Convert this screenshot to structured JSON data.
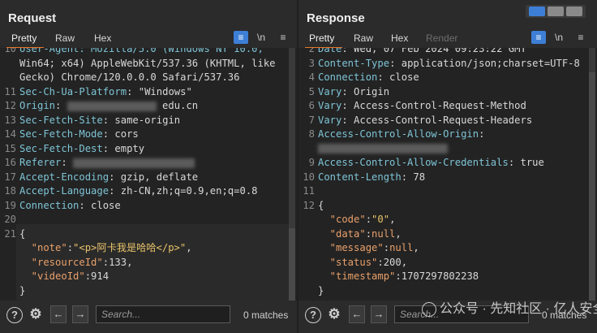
{
  "request": {
    "title": "Request",
    "tabs": [
      "Pretty",
      "Raw",
      "Hex"
    ],
    "lines": [
      {
        "n": "10",
        "segs": [
          {
            "t": "User-Agent: Mozilla/5.0 (Windows NT 10.0;",
            "c": "hk"
          }
        ]
      },
      {
        "n": "",
        "segs": [
          {
            "t": "Win64; x64) AppleWebKit/537.36 (KHTML, like",
            "c": ""
          }
        ]
      },
      {
        "n": "",
        "segs": [
          {
            "t": "Gecko) Chrome/120.0.0.0 Safari/537.36",
            "c": ""
          }
        ]
      },
      {
        "n": "11",
        "segs": [
          {
            "t": "Sec-Ch-Ua-Platform",
            "c": "hk"
          },
          {
            "t": ": \"Windows\"",
            "c": ""
          }
        ]
      },
      {
        "n": "12",
        "segs": [
          {
            "t": "Origin",
            "c": "hk"
          },
          {
            "t": ": ",
            "c": ""
          },
          {
            "t": "",
            "c": "blur",
            "w": 110
          },
          {
            "t": " edu.cn",
            "c": ""
          }
        ]
      },
      {
        "n": "13",
        "segs": [
          {
            "t": "Sec-Fetch-Site",
            "c": "hk"
          },
          {
            "t": ": same-origin",
            "c": ""
          }
        ]
      },
      {
        "n": "14",
        "segs": [
          {
            "t": "Sec-Fetch-Mode",
            "c": "hk"
          },
          {
            "t": ": cors",
            "c": ""
          }
        ]
      },
      {
        "n": "15",
        "segs": [
          {
            "t": "Sec-Fetch-Dest",
            "c": "hk"
          },
          {
            "t": ": empty",
            "c": ""
          }
        ]
      },
      {
        "n": "16",
        "segs": [
          {
            "t": "Referer",
            "c": "hk"
          },
          {
            "t": ": ",
            "c": ""
          },
          {
            "t": "",
            "c": "blur",
            "w": 150
          }
        ]
      },
      {
        "n": "17",
        "segs": [
          {
            "t": "Accept-Encoding",
            "c": "hk"
          },
          {
            "t": ": gzip, deflate",
            "c": ""
          }
        ]
      },
      {
        "n": "18",
        "segs": [
          {
            "t": "Accept-Language",
            "c": "hk"
          },
          {
            "t": ": zh-CN,zh;q=0.9,en;q=0.8",
            "c": ""
          }
        ]
      },
      {
        "n": "19",
        "segs": [
          {
            "t": "Connection",
            "c": "hk"
          },
          {
            "t": ": close",
            "c": ""
          }
        ]
      },
      {
        "n": "20",
        "segs": []
      },
      {
        "n": "21",
        "segs": [
          {
            "t": "{",
            "c": ""
          }
        ]
      },
      {
        "n": "",
        "segs": [
          {
            "t": "  \"note\"",
            "c": "jk"
          },
          {
            "t": ":",
            "c": ""
          },
          {
            "t": "\"<p>阿卡我是哈哈</p>\"",
            "c": "js"
          },
          {
            "t": ",",
            "c": ""
          }
        ]
      },
      {
        "n": "",
        "segs": [
          {
            "t": "  \"resourceId\"",
            "c": "jk"
          },
          {
            "t": ":133,",
            "c": ""
          }
        ]
      },
      {
        "n": "",
        "segs": [
          {
            "t": "  \"videoId\"",
            "c": "jk"
          },
          {
            "t": ":914",
            "c": ""
          }
        ]
      },
      {
        "n": "",
        "segs": [
          {
            "t": "}",
            "c": ""
          }
        ]
      }
    ],
    "search_placeholder": "Search...",
    "matches": "0 matches"
  },
  "response": {
    "title": "Response",
    "tabs": [
      "Pretty",
      "Raw",
      "Hex",
      "Render"
    ],
    "lines": [
      {
        "n": "2",
        "segs": [
          {
            "t": "Date",
            "c": "hk"
          },
          {
            "t": ": Wed, 07 Feb 2024 09:23:22 GMT",
            "c": ""
          }
        ]
      },
      {
        "n": "3",
        "segs": [
          {
            "t": "Content-Type",
            "c": "hk"
          },
          {
            "t": ": application/json;charset=UTF-8",
            "c": ""
          }
        ]
      },
      {
        "n": "4",
        "segs": [
          {
            "t": "Connection",
            "c": "hk"
          },
          {
            "t": ": close",
            "c": ""
          }
        ]
      },
      {
        "n": "5",
        "segs": [
          {
            "t": "Vary",
            "c": "hk"
          },
          {
            "t": ": Origin",
            "c": ""
          }
        ]
      },
      {
        "n": "6",
        "segs": [
          {
            "t": "Vary",
            "c": "hk"
          },
          {
            "t": ": Access-Control-Request-Method",
            "c": ""
          }
        ]
      },
      {
        "n": "7",
        "segs": [
          {
            "t": "Vary",
            "c": "hk"
          },
          {
            "t": ": Access-Control-Request-Headers",
            "c": ""
          }
        ]
      },
      {
        "n": "8",
        "segs": [
          {
            "t": "Access-Control-Allow-Origin",
            "c": "hk"
          },
          {
            "t": ":",
            "c": ""
          }
        ]
      },
      {
        "n": "",
        "segs": [
          {
            "t": "",
            "c": "blur",
            "w": 160
          }
        ]
      },
      {
        "n": "9",
        "segs": [
          {
            "t": "Access-Control-Allow-Credentials",
            "c": "hk"
          },
          {
            "t": ": true",
            "c": ""
          }
        ]
      },
      {
        "n": "10",
        "segs": [
          {
            "t": "Content-Length",
            "c": "hk"
          },
          {
            "t": ": 78",
            "c": ""
          }
        ]
      },
      {
        "n": "11",
        "segs": []
      },
      {
        "n": "12",
        "segs": [
          {
            "t": "{",
            "c": ""
          }
        ]
      },
      {
        "n": "",
        "segs": [
          {
            "t": "  \"code\"",
            "c": "jk"
          },
          {
            "t": ":",
            "c": ""
          },
          {
            "t": "\"0\"",
            "c": "js"
          },
          {
            "t": ",",
            "c": ""
          }
        ]
      },
      {
        "n": "",
        "segs": [
          {
            "t": "  \"data\"",
            "c": "jk"
          },
          {
            "t": ":",
            "c": ""
          },
          {
            "t": "null",
            "c": "jk"
          },
          {
            "t": ",",
            "c": ""
          }
        ]
      },
      {
        "n": "",
        "segs": [
          {
            "t": "  \"message\"",
            "c": "jk"
          },
          {
            "t": ":",
            "c": ""
          },
          {
            "t": "null",
            "c": "jk"
          },
          {
            "t": ",",
            "c": ""
          }
        ]
      },
      {
        "n": "",
        "segs": [
          {
            "t": "  \"status\"",
            "c": "jk"
          },
          {
            "t": ":200,",
            "c": ""
          }
        ]
      },
      {
        "n": "",
        "segs": [
          {
            "t": "  \"timestamp\"",
            "c": "jk"
          },
          {
            "t": ":1707297802238",
            "c": ""
          }
        ]
      },
      {
        "n": "",
        "segs": [
          {
            "t": "}",
            "c": ""
          }
        ]
      }
    ],
    "search_placeholder": "Search...",
    "matches": "0 matches"
  },
  "icons": {
    "help": "?",
    "settings": "⚙",
    "back": "←",
    "forward": "→",
    "newline": "\\n",
    "menu": "≡",
    "wrap": "≡"
  },
  "watermark": "公众号 · 先知社区 · 亿人安全",
  "colors": {
    "accent": "#e8762b",
    "header_key": "#7ec4d6",
    "json_key": "#e9a06a",
    "json_string": "#e9c46a"
  }
}
